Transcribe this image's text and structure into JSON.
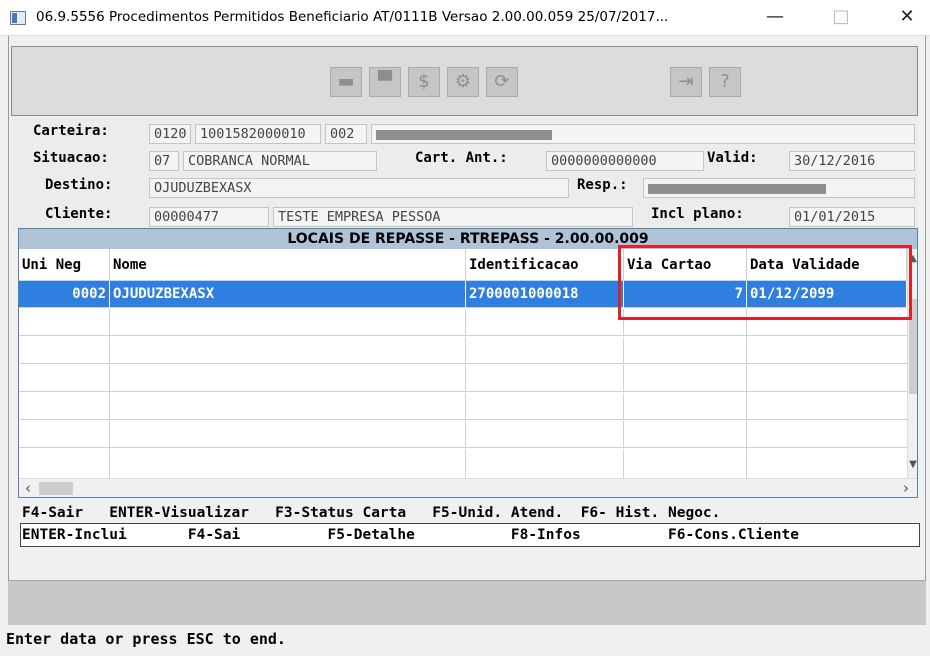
{
  "window": {
    "title": "06.9.5556 Procedimentos Permitidos Beneficiario AT/0111B Versao 2.00.00.059 25/07/2017...",
    "minimize": "—",
    "maximize": "□",
    "close": "✕"
  },
  "toolbar": {
    "icons": [
      {
        "name": "briefcase-icon",
        "glyph": "▬"
      },
      {
        "name": "person-card-icon",
        "glyph": "▀"
      },
      {
        "name": "money-icon",
        "glyph": "$"
      },
      {
        "name": "tools-icon",
        "glyph": "⚙"
      },
      {
        "name": "refresh-icon",
        "glyph": "⟳"
      },
      {
        "name": "exit-door-icon",
        "glyph": "⇥"
      },
      {
        "name": "help-icon",
        "glyph": "?"
      }
    ]
  },
  "form": {
    "carteira_label": "Carteira:",
    "carteira_unidade": "0120",
    "carteira_numero": "1001582000010",
    "carteira_digito": "002",
    "situacao_label": "Situacao:",
    "situacao_codigo": "07",
    "situacao_descricao": "COBRANCA NORMAL",
    "cart_ant_label": "Cart. Ant.:",
    "cart_ant_valor": "0000000000000",
    "valid_label": "Valid:",
    "valid_valor": "30/12/2016",
    "destino_label": "Destino:",
    "destino_valor": "OJUDUZBEXASX",
    "resp_label": "Resp.:",
    "cliente_label": "Cliente:",
    "cliente_codigo": "00000477",
    "cliente_nome": "TESTE EMPRESA PESSOA",
    "incl_plano_label": "Incl plano:",
    "incl_plano_valor": "01/01/2015"
  },
  "dialog": {
    "title": "LOCAIS DE REPASSE - RTREPASS - 2.00.00.009",
    "columns": [
      "Uni Neg",
      "Nome",
      "Identificacao",
      "Via Cartao",
      "Data Validade"
    ],
    "rows": [
      {
        "uni_neg": "0002",
        "nome": "OJUDUZBEXASX",
        "identificacao": "2700001000018",
        "via_cartao": "7",
        "data_validade": "01/12/2099"
      }
    ],
    "empty_row_count": 6
  },
  "fkeys": {
    "dialog_keys": "F4-Sair   ENTER-Visualizar   F3-Status Carta   F5-Unid. Atend.  F6- Hist. Negoc.",
    "main_keys": "ENTER-Inclui       F4-Sai          F5-Detalhe           F8-Infos          F6-Cons.Cliente"
  },
  "status_line": "Enter data or press ESC to end.",
  "colors": {
    "selection": "#2f7fe0",
    "dialog_title_bg": "#b0c4d8",
    "highlight_box": "#e0202a"
  }
}
